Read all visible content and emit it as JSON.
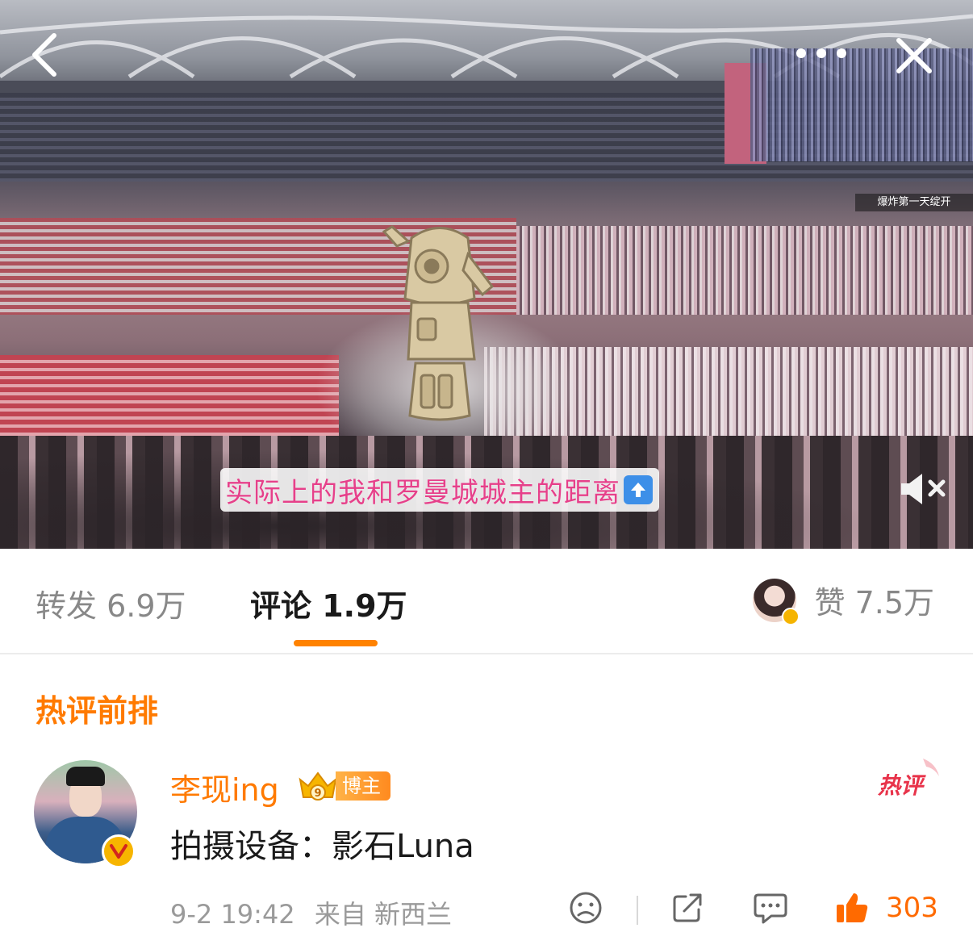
{
  "video": {
    "caption": "实际上的我和罗曼城城主的距离",
    "background_sign": "爆炸第一天绽开",
    "icons": {
      "back": "chevron-left-icon",
      "more": "more-dots-icon",
      "close": "close-icon",
      "mute": "volume-muted-icon",
      "caption_arrow": "up-arrow-emoji"
    }
  },
  "tabs": {
    "repost": "转发 6.9万",
    "comment": "评论 1.9万",
    "like": "赞 7.5万",
    "active": "comment",
    "accent": "#ff8200"
  },
  "comments_section": {
    "title": "热评前排",
    "title_color": "#ff7a00"
  },
  "comment": {
    "username": "李现ing",
    "badge": "博主",
    "badge_level": "9",
    "hot_tag": "热评",
    "text": "拍摄设备：影石Luna",
    "date": "9-2 19:42",
    "source": "来自 新西兰",
    "like_count": "303",
    "icons": [
      "sad-face-icon",
      "share-icon",
      "reply-icon",
      "thumbs-up-icon"
    ]
  }
}
